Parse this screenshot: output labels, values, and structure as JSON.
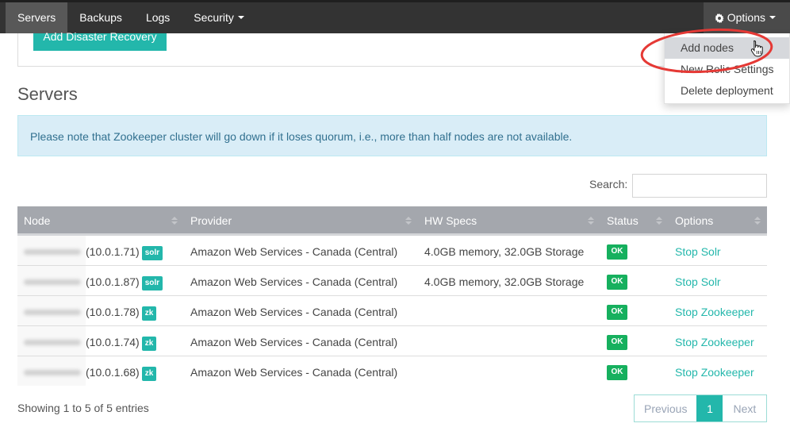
{
  "navbar": {
    "items": [
      {
        "label": "Servers",
        "active": true
      },
      {
        "label": "Backups",
        "active": false
      },
      {
        "label": "Logs",
        "active": false
      },
      {
        "label": "Security",
        "active": false,
        "has_dropdown": true
      }
    ],
    "options": {
      "label": "Options",
      "icon": "gear-icon",
      "has_dropdown": true
    }
  },
  "top_panel": {
    "add_disaster_recovery_label": "Add Disaster Recovery"
  },
  "options_menu": {
    "items": [
      {
        "label": "Add nodes",
        "hovered": true
      },
      {
        "label": "New Relic Settings",
        "hovered": false
      },
      {
        "label": "Delete deployment",
        "hovered": false
      }
    ]
  },
  "page": {
    "title": "Servers",
    "alert": "Please note that Zookeeper cluster will go down if it loses quorum, i.e., more than half nodes are not available."
  },
  "search": {
    "label": "Search:",
    "value": "",
    "placeholder": ""
  },
  "table": {
    "columns": [
      "Node",
      "Provider",
      "HW Specs",
      "Status",
      "Options"
    ],
    "rows": [
      {
        "node_name": "[redacted]",
        "ip": "(10.0.1.71)",
        "tag": "solr",
        "provider": "Amazon Web Services - Canada (Central)",
        "hw_specs": "4.0GB memory, 32.0GB Storage",
        "status": "OK",
        "option": "Stop Solr"
      },
      {
        "node_name": "[redacted]",
        "ip": "(10.0.1.87)",
        "tag": "solr",
        "provider": "Amazon Web Services - Canada (Central)",
        "hw_specs": "4.0GB memory, 32.0GB Storage",
        "status": "OK",
        "option": "Stop Solr"
      },
      {
        "node_name": "[redacted]",
        "ip": "(10.0.1.78)",
        "tag": "zk",
        "provider": "Amazon Web Services - Canada (Central)",
        "hw_specs": "",
        "status": "OK",
        "option": "Stop Zookeeper"
      },
      {
        "node_name": "[redacted]",
        "ip": "(10.0.1.74)",
        "tag": "zk",
        "provider": "Amazon Web Services - Canada (Central)",
        "hw_specs": "",
        "status": "OK",
        "option": "Stop Zookeeper"
      },
      {
        "node_name": "[redacted]",
        "ip": "(10.0.1.68)",
        "tag": "zk",
        "provider": "Amazon Web Services - Canada (Central)",
        "hw_specs": "",
        "status": "OK",
        "option": "Stop Zookeeper"
      }
    ]
  },
  "footer": {
    "info": "Showing 1 to 5 of 5 entries",
    "pagination": {
      "previous": "Previous",
      "current": "1",
      "next": "Next"
    }
  },
  "colors": {
    "navbar": "#333333",
    "accent": "#23b7ab",
    "ok_badge": "#16b05e",
    "alert_bg": "#d9edf7",
    "alert_text": "#31708f",
    "table_header": "#a4a7ad",
    "annotation": "#e53935"
  }
}
